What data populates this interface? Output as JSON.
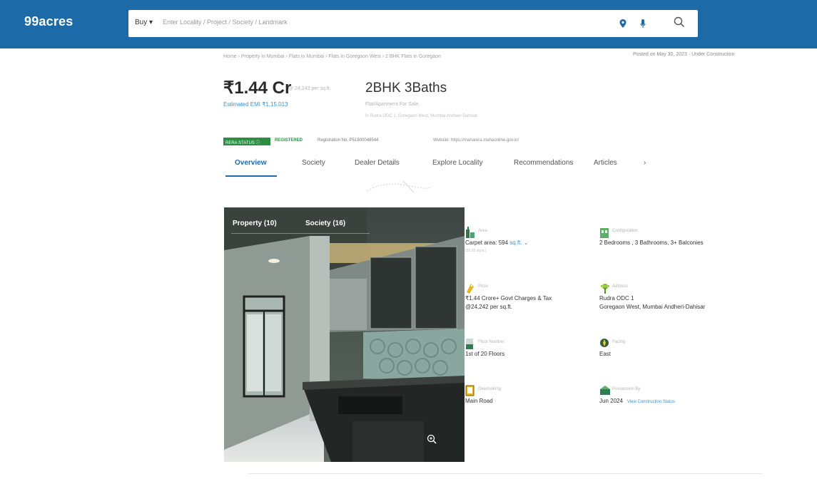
{
  "header": {
    "logo": "99acres",
    "search": {
      "mode": "Buy",
      "placeholder": "Enter Locality / Project / Society / Landmark"
    }
  },
  "listing": {
    "breadcrumb": "Home › Property in Mumbai › Flats in Mumbai › Flats in Goregaon West › 2 BHK Flats in Goregaon",
    "posted": "Posted on May 30, 2023 · Under Construction",
    "price": "₹1.44 Cr",
    "price_per_sqft": "@ 24,242 per sq.ft.",
    "emi": "Estimated EMI ₹1,15,013",
    "title": "2BHK 3Baths",
    "subtitle": "Flat/Apartment For Sale",
    "subtitle2": "in Rudra ODC 1, Goregaon West, Mumbai Andheri-Dahisar",
    "rera_status": "RERA STATUS",
    "registered": "REGISTERED",
    "registration_no": "Registration No. P51800048544",
    "website": "Website: https://maharera.mahaonline.gov.in/"
  },
  "tabs": [
    "Overview",
    "Society",
    "Dealer Details",
    "Explore Locality",
    "Recommendations",
    "Articles"
  ],
  "gallery": {
    "tab_property": "Property (10)",
    "tab_society": "Society (16)"
  },
  "details": {
    "area": {
      "label": "Area",
      "value": "Carpet area: 594",
      "unit": "sq.ft.",
      "sub": "(55.18 sq.m.)"
    },
    "configuration": {
      "label": "Configuration",
      "value": "2 Bedrooms , 3 Bathrooms, 3+ Balconies"
    },
    "price": {
      "label": "Price",
      "value": "₹1.44 Crore+ Govt Charges & Tax",
      "value2": "@24,242 per sq.ft."
    },
    "address": {
      "label": "Address",
      "value": "Rudra ODC 1",
      "value2": "Goregaon West, Mumbai Andheri-Dahisar"
    },
    "floor": {
      "label": "Floor Number",
      "value": "1st of 20 Floors"
    },
    "facing": {
      "label": "Facing",
      "value": "East"
    },
    "overlooking": {
      "label": "Overlooking",
      "value": "Main Road"
    },
    "possession": {
      "label": "Possession By",
      "value": "Jun 2024",
      "link": "View Construction Status"
    }
  },
  "colors": {
    "brand": "#1c6aa8",
    "link": "#3f8fcf",
    "rera_green": "#2e8d44"
  },
  "icons": [
    "location-pin-icon",
    "microphone-icon",
    "search-icon",
    "info-icon",
    "chevron-right-icon",
    "zoom-in-icon",
    "area-icon",
    "configuration-icon",
    "price-icon",
    "address-icon",
    "floor-icon",
    "facing-icon",
    "overlooking-icon",
    "possession-icon"
  ]
}
